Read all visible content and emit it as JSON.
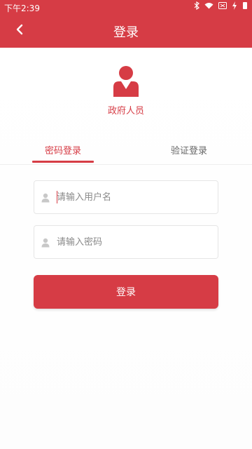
{
  "status_bar": {
    "time": "下午2:39",
    "icons": [
      "bluetooth-icon",
      "wifi-icon",
      "battery-icon",
      "charging-icon"
    ]
  },
  "app_bar": {
    "title": "登录",
    "back_icon": "chevron-left-icon"
  },
  "header": {
    "role_icon": "person-icon",
    "role_label": "政府人员"
  },
  "tabs": [
    {
      "label": "密码登录",
      "active": true
    },
    {
      "label": "验证登录",
      "active": false
    }
  ],
  "form": {
    "username": {
      "placeholder": "请输入用户名",
      "value": ""
    },
    "password": {
      "placeholder": "请输入密码",
      "value": ""
    },
    "submit_label": "登录"
  },
  "colors": {
    "accent": "#d63c45",
    "placeholder": "#8a8a8a",
    "border": "#e6e6e6"
  }
}
